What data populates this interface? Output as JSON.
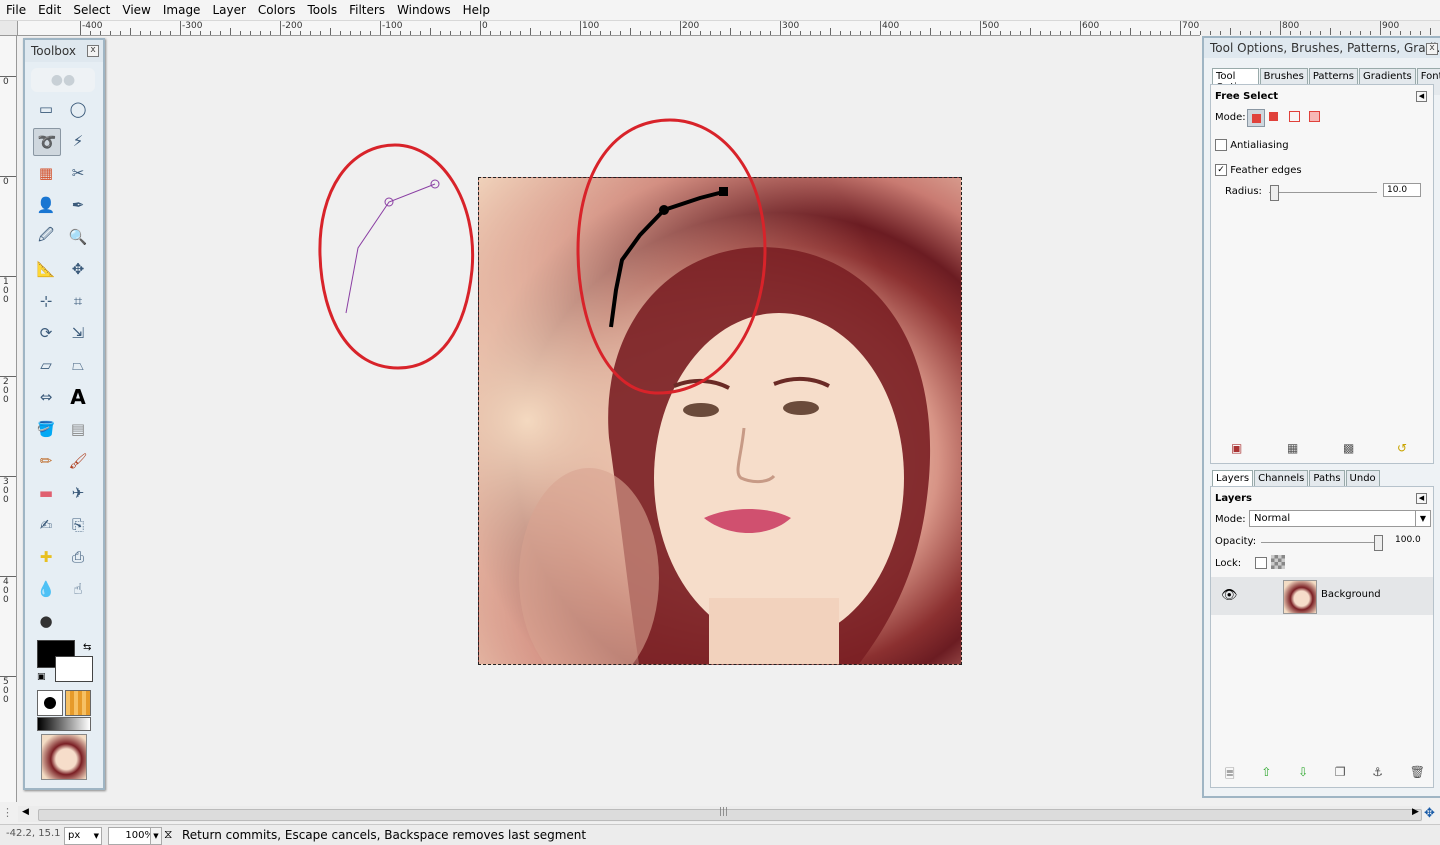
{
  "menubar": {
    "items": [
      {
        "label": "File"
      },
      {
        "label": "Edit"
      },
      {
        "label": "Select"
      },
      {
        "label": "View"
      },
      {
        "label": "Image"
      },
      {
        "label": "Layer"
      },
      {
        "label": "Colors"
      },
      {
        "label": "Tools"
      },
      {
        "label": "Filters"
      },
      {
        "label": "Windows"
      },
      {
        "label": "Help"
      }
    ]
  },
  "ruler": {
    "h_labels": [
      "-400",
      "-300",
      "-200",
      "-100",
      "0",
      "100",
      "200",
      "300",
      "400",
      "500",
      "600",
      "700",
      "800",
      "900"
    ],
    "v_labels": [
      "0",
      "0",
      "1\n0\n0",
      "2\n0\n0",
      "3\n0\n0",
      "4\n0\n0",
      "5\n0\n0"
    ]
  },
  "toolbox": {
    "title": "Toolbox",
    "close": "x",
    "tools": [
      "rect-select",
      "ellipse-select",
      "free-select",
      "fuzzy-select",
      "select-by-color",
      "scissors",
      "foreground-select",
      "paths",
      "color-picker",
      "zoom",
      "measure",
      "move",
      "align",
      "crop",
      "rotate",
      "scale",
      "shear",
      "perspective",
      "flip",
      "text",
      "bucket-fill",
      "blend",
      "pencil",
      "paintbrush",
      "eraser",
      "airbrush",
      "ink",
      "clone",
      "heal",
      "perspective-clone",
      "blur",
      "smudge",
      "dodge-burn"
    ]
  },
  "dock": {
    "title": "Tool Options, Brushes, Patterns, Gradi...",
    "close": "x",
    "top_tabs": [
      "Tool Options",
      "Brushes",
      "Patterns",
      "Gradients",
      "Fonts"
    ],
    "tool_options": {
      "heading": "Free Select",
      "mode_label": "Mode:",
      "antialiasing": "Antialiasing",
      "feather": "Feather edges",
      "radius_label": "Radius:",
      "radius_value": "10.0",
      "radius_fraction": 0.04
    },
    "bottom_tabs": [
      "Layers",
      "Channels",
      "Paths",
      "Undo"
    ],
    "layers": {
      "heading": "Layers",
      "mode_label": "Mode:",
      "mode_value": "Normal",
      "opacity_label": "Opacity:",
      "opacity_value": "100.0",
      "lock_label": "Lock:",
      "layer_name": "Background"
    }
  },
  "status": {
    "coords": "-42.2, 15.1",
    "unit": "px",
    "zoom": "100%",
    "message": "Return commits, Escape cancels, Backspace removes last segment"
  },
  "colors": {
    "accent": "#9fb5c4",
    "annotation_red": "#d8232a"
  }
}
